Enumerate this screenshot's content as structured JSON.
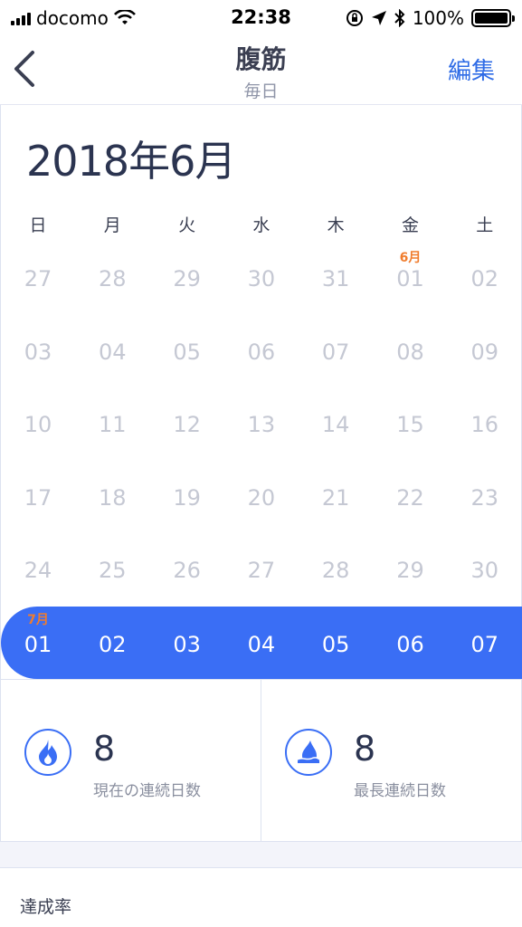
{
  "status_bar": {
    "carrier": "docomo",
    "time": "22:38",
    "battery": "100%"
  },
  "nav": {
    "title": "腹筋",
    "subtitle": "毎日",
    "edit_label": "編集"
  },
  "calendar": {
    "month_title": "2018年6月",
    "weekdays": [
      "日",
      "月",
      "火",
      "水",
      "木",
      "金",
      "土"
    ],
    "weeks": [
      [
        {
          "d": "27"
        },
        {
          "d": "28"
        },
        {
          "d": "29"
        },
        {
          "d": "30"
        },
        {
          "d": "31"
        },
        {
          "d": "01",
          "m": "6月"
        },
        {
          "d": "02"
        }
      ],
      [
        {
          "d": "03"
        },
        {
          "d": "04"
        },
        {
          "d": "05"
        },
        {
          "d": "06"
        },
        {
          "d": "07"
        },
        {
          "d": "08"
        },
        {
          "d": "09"
        }
      ],
      [
        {
          "d": "10"
        },
        {
          "d": "11"
        },
        {
          "d": "12"
        },
        {
          "d": "13"
        },
        {
          "d": "14"
        },
        {
          "d": "15"
        },
        {
          "d": "16"
        }
      ],
      [
        {
          "d": "17"
        },
        {
          "d": "18"
        },
        {
          "d": "19"
        },
        {
          "d": "20"
        },
        {
          "d": "21"
        },
        {
          "d": "22"
        },
        {
          "d": "23"
        }
      ],
      [
        {
          "d": "24"
        },
        {
          "d": "25"
        },
        {
          "d": "26"
        },
        {
          "d": "27"
        },
        {
          "d": "28"
        },
        {
          "d": "29"
        },
        {
          "d": "30"
        }
      ]
    ],
    "current_week": [
      {
        "d": "01",
        "m": "7月"
      },
      {
        "d": "02"
      },
      {
        "d": "03"
      },
      {
        "d": "04"
      },
      {
        "d": "05"
      },
      {
        "d": "06"
      },
      {
        "d": "07"
      }
    ]
  },
  "stats": {
    "current_streak": {
      "value": "8",
      "label": "現在の連続日数",
      "icon": "flame-icon"
    },
    "longest_streak": {
      "value": "8",
      "label": "最長連続日数",
      "icon": "drop-icon"
    }
  },
  "rate": {
    "title": "達成率"
  },
  "colors": {
    "accent": "#3a6ef5",
    "month_marker": "#f07c2d",
    "inactive_day": "#c5c8d3"
  }
}
